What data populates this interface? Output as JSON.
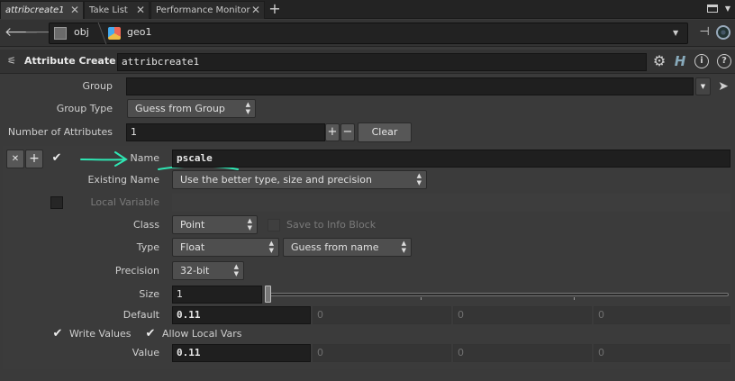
{
  "tabs": [
    {
      "label": "attribcreate1"
    },
    {
      "label": "Take List"
    },
    {
      "label": "Performance Monitor"
    }
  ],
  "path": {
    "obj": "obj",
    "geo": "geo1"
  },
  "node": {
    "type": "Attribute Create",
    "name": "attribcreate1"
  },
  "params": {
    "group_label": "Group",
    "group_value": "",
    "group_type_label": "Group Type",
    "group_type_value": "Guess from Group",
    "num_attr_label": "Number of Attributes",
    "num_attr_value": "1",
    "clear_label": "Clear",
    "name_label": "Name",
    "name_value": "pscale",
    "existing_name_label": "Existing Name",
    "existing_name_value": "Use the better type, size and precision",
    "local_var_label": "Local Variable",
    "class_label": "Class",
    "class_value": "Point",
    "save_info_label": "Save to Info Block",
    "type_label": "Type",
    "type_value": "Float",
    "type_guess_value": "Guess from name",
    "precision_label": "Precision",
    "precision_value": "32-bit",
    "size_label": "Size",
    "size_value": "1",
    "default_label": "Default",
    "default_values": [
      "0.11",
      "0",
      "0",
      "0"
    ],
    "write_values_label": "Write Values",
    "allow_local_vars_label": "Allow Local Vars",
    "value_label": "Value",
    "value_values": [
      "0.11",
      "0",
      "0",
      "0"
    ]
  },
  "colors": {
    "annotation": "#2ee6b3"
  }
}
